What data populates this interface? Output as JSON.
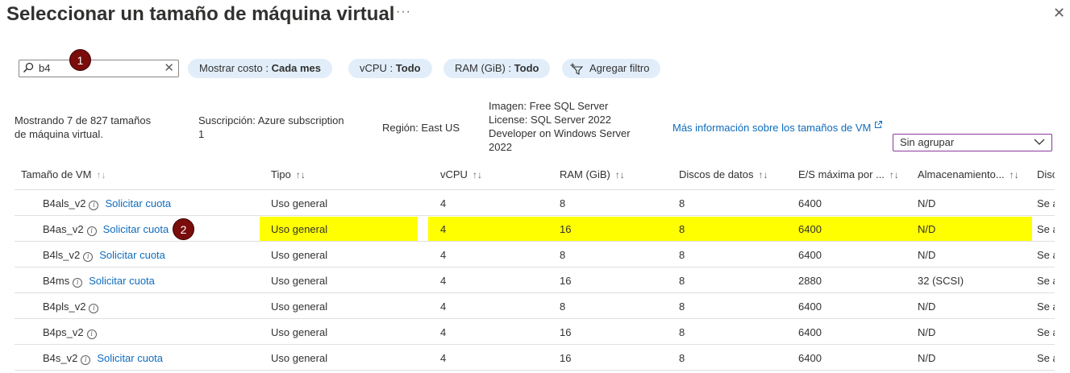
{
  "title": "Seleccionar un tamaño de máquina virtual",
  "more_label": "···",
  "close_label": "✕",
  "search": {
    "value": "b4",
    "placeholder": ""
  },
  "badges": {
    "one": "1",
    "two": "2"
  },
  "filters": [
    {
      "label": "Mostrar costo : ",
      "value": "Cada mes"
    },
    {
      "label": "vCPU : ",
      "value": "Todo"
    },
    {
      "label": "RAM (GiB) : ",
      "value": "Todo"
    }
  ],
  "add_filter_label": "Agregar filtro",
  "summary": {
    "showing_line1": "Mostrando 7 de 827 tamaños",
    "showing_line2": "de máquina virtual.",
    "subscription_line1": "Suscripción: Azure subscription",
    "subscription_line2": "1",
    "region": "Región: East US",
    "image_line1": "Imagen: Free SQL Server",
    "image_line2": "License: SQL Server 2022",
    "image_line3": "Developer on Windows Server",
    "image_line4": "2022",
    "more_info_link": "Más información sobre los tamaños de VM",
    "group_by": "Sin agrupar"
  },
  "columns": [
    "Tamaño de VM",
    "Tipo",
    "vCPU",
    "RAM (GiB)",
    "Discos de datos",
    "E/S máxima por ...",
    "Almacenamiento...",
    "Disc"
  ],
  "sort_glyph": "↑↓",
  "quota_label": "Solicitar cuota",
  "rows": [
    {
      "name": "B4als_v2",
      "quota": true,
      "type": "Uso general",
      "vcpu": "4",
      "ram": "8",
      "disks": "8",
      "iops": "6400",
      "storage": "N/D",
      "disc": "Se a",
      "highlight": false
    },
    {
      "name": "B4as_v2",
      "quota": true,
      "type": "Uso general",
      "vcpu": "4",
      "ram": "16",
      "disks": "8",
      "iops": "6400",
      "storage": "N/D",
      "disc": "Se a",
      "highlight": true
    },
    {
      "name": "B4ls_v2",
      "quota": true,
      "type": "Uso general",
      "vcpu": "4",
      "ram": "8",
      "disks": "8",
      "iops": "6400",
      "storage": "N/D",
      "disc": "Se a",
      "highlight": false
    },
    {
      "name": "B4ms",
      "quota": true,
      "type": "Uso general",
      "vcpu": "4",
      "ram": "16",
      "disks": "8",
      "iops": "2880",
      "storage": "32 (SCSI)",
      "disc": "Se a",
      "highlight": false
    },
    {
      "name": "B4pls_v2",
      "quota": false,
      "type": "Uso general",
      "vcpu": "4",
      "ram": "8",
      "disks": "8",
      "iops": "6400",
      "storage": "N/D",
      "disc": "Se a",
      "highlight": false
    },
    {
      "name": "B4ps_v2",
      "quota": false,
      "type": "Uso general",
      "vcpu": "4",
      "ram": "16",
      "disks": "8",
      "iops": "6400",
      "storage": "N/D",
      "disc": "Se a",
      "highlight": false
    },
    {
      "name": "B4s_v2",
      "quota": true,
      "type": "Uso general",
      "vcpu": "4",
      "ram": "16",
      "disks": "8",
      "iops": "6400",
      "storage": "N/D",
      "disc": "Se a",
      "highlight": false
    }
  ],
  "colors": {
    "accent": "#0f6cbd",
    "highlight": "#ffff00",
    "badge": "#7a0c0c",
    "pill": "#e1eefa"
  }
}
